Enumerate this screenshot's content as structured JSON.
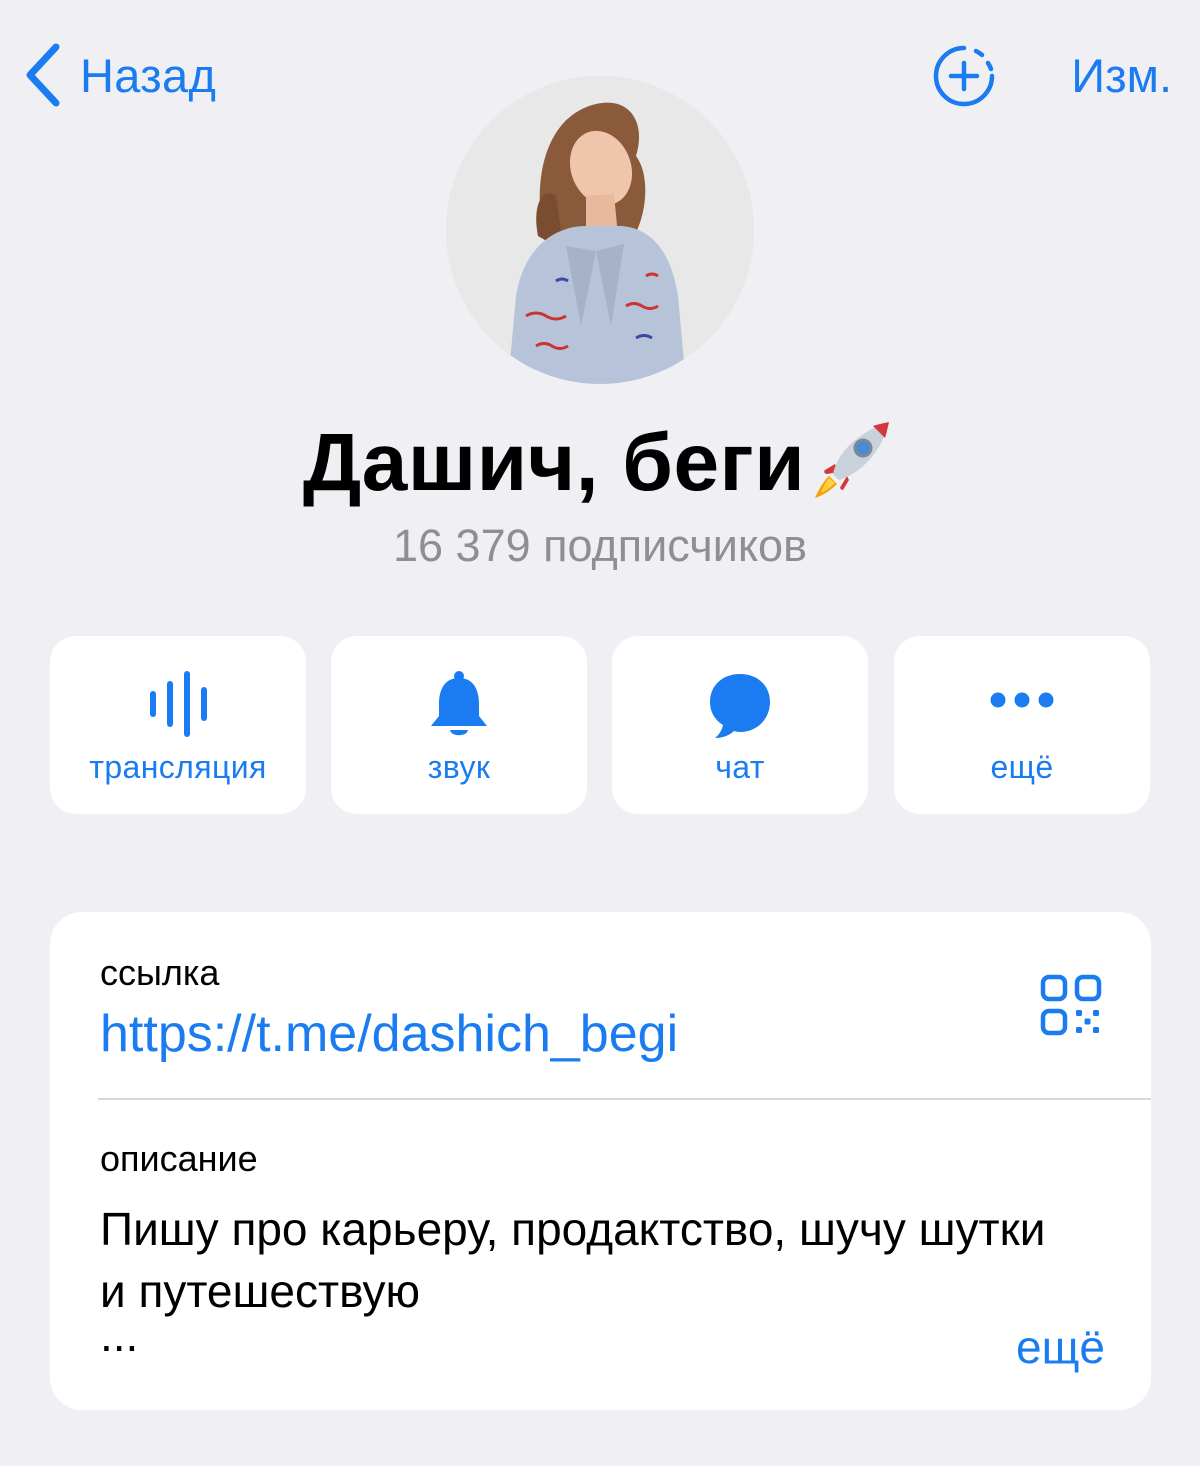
{
  "nav": {
    "back_label": "Назад",
    "edit_label": "Изм."
  },
  "channel": {
    "name": "Дашич, беги",
    "subscribers": "16 379 подписчиков"
  },
  "actions": [
    {
      "label": "трансляция",
      "icon": "voice-chat-icon"
    },
    {
      "label": "звук",
      "icon": "bell-icon"
    },
    {
      "label": "чат",
      "icon": "chat-bubble-icon"
    },
    {
      "label": "ещё",
      "icon": "more-dots-icon"
    }
  ],
  "info": {
    "link_title": "ссылка",
    "link_value": "https://t.me/dashich_begi",
    "description_title": "описание",
    "description_text": "Пишу про карьеру, продактство, шучу шутки и путешествую",
    "description_ellipsis": "...",
    "description_more": "ещё"
  },
  "colors": {
    "accent": "#1a7cf0",
    "background": "#efeff4",
    "card": "#ffffff",
    "secondary_text": "#8e8e93"
  }
}
